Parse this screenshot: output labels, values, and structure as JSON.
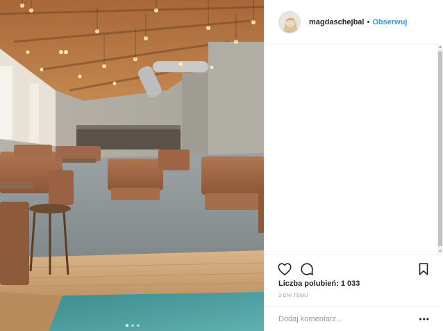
{
  "post": {
    "username": "magdaschejbal",
    "separator": "•",
    "follow_label": "Obserwuj",
    "likes_label": "Liczba polubień:",
    "likes_count": "1 033",
    "timestamp": "3 DNI TEMU",
    "comment_placeholder": "Dodaj komentarz...",
    "more_label": "•••"
  },
  "icons": {
    "like": "heart-icon",
    "comment": "comment-icon",
    "save": "bookmark-icon",
    "more": "more-options-icon"
  },
  "colors": {
    "follow": "#3897f0",
    "text": "#262626",
    "muted": "#999999",
    "border": "#efefef"
  }
}
